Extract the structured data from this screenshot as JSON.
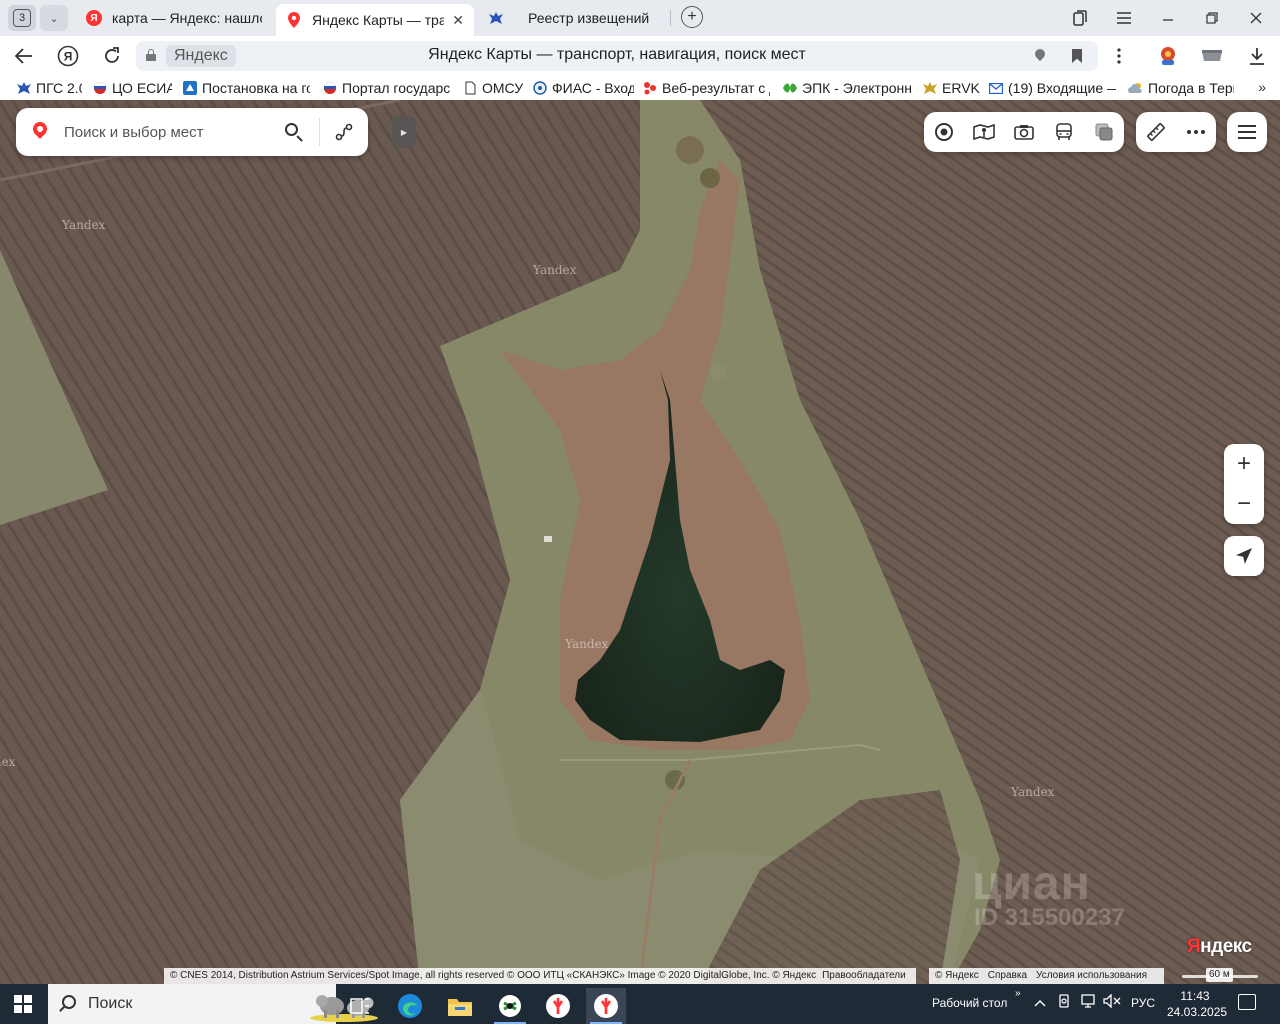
{
  "browser": {
    "tab_counter": "3",
    "tabs": [
      {
        "label": "карта — Яндекс: нашлось",
        "favicon": "yandex-ya-icon",
        "active": false
      },
      {
        "label": "Яндекс Карты — транс",
        "favicon": "yandex-maps-pin-icon",
        "active": true
      },
      {
        "label": "Реестр извещений",
        "favicon": "eagle-emblem-icon",
        "active": false
      }
    ],
    "new_tab": "+",
    "window_controls": [
      "tabs-collection-icon",
      "menu-icon",
      "minimize-icon",
      "restore-icon",
      "close-icon"
    ]
  },
  "address_bar": {
    "domain": "Яндекс",
    "title": "Яндекс Карты — транспорт, навигация, поиск мест"
  },
  "bookmarks": [
    {
      "label": "ПГС 2.0",
      "icon": "eagle-emblem-icon"
    },
    {
      "label": "ЦО ЕСИА",
      "icon": "russia-flag-icon"
    },
    {
      "label": "Постановка на го",
      "icon": "gosuslugi-icon"
    },
    {
      "label": "Портал государст",
      "icon": "russia-flag-icon"
    },
    {
      "label": "ОМСУ",
      "icon": "document-icon"
    },
    {
      "label": "ФИАС - Вход",
      "icon": "fias-icon"
    },
    {
      "label": "Веб-результат с д",
      "icon": "web-result-icon"
    },
    {
      "label": "ЭПК - Электронна",
      "icon": "epk-icon"
    },
    {
      "label": "ERVK",
      "icon": "eagle-emblem-icon"
    },
    {
      "label": "(19) Входящие —",
      "icon": "mail-icon"
    },
    {
      "label": "Погода в Терн",
      "icon": "weather-icon"
    }
  ],
  "map": {
    "search_placeholder": "Поиск и выбор мест",
    "watermark": "Yandex",
    "zoom_in": "+",
    "zoom_out": "−",
    "cian_watermark": "циан",
    "cian_id": "ID 315500237",
    "logo": {
      "first": "Я",
      "rest": "ндекс"
    },
    "copyright": "© CNES 2014, Distribution Astrium Services/Spot Image, all rights reserved © ООО ИТЦ «СКАНЭКС» Image © 2020 DigitalGlobe, Inc. © Яндекс",
    "copyright_holders": "Правообладатели",
    "legal": [
      "© Яндекс",
      "Справка",
      "Условия использования"
    ],
    "scale": "60 м",
    "colors": {
      "field": "#6b5a50",
      "grass": "#8a8a6e",
      "water": "#1e2e22",
      "reeds": "#9a7a62"
    }
  },
  "taskbar": {
    "search_label": "Поиск",
    "desktop_label": "Рабочий стол",
    "chevron": "»",
    "language": "РУС",
    "time": "11:43",
    "date": "24.03.2025",
    "apps": [
      "task-view-icon",
      "edge-icon",
      "file-explorer-icon",
      "game-app-icon",
      "yandex-browser-icon",
      "yandex-browser-icon"
    ]
  }
}
